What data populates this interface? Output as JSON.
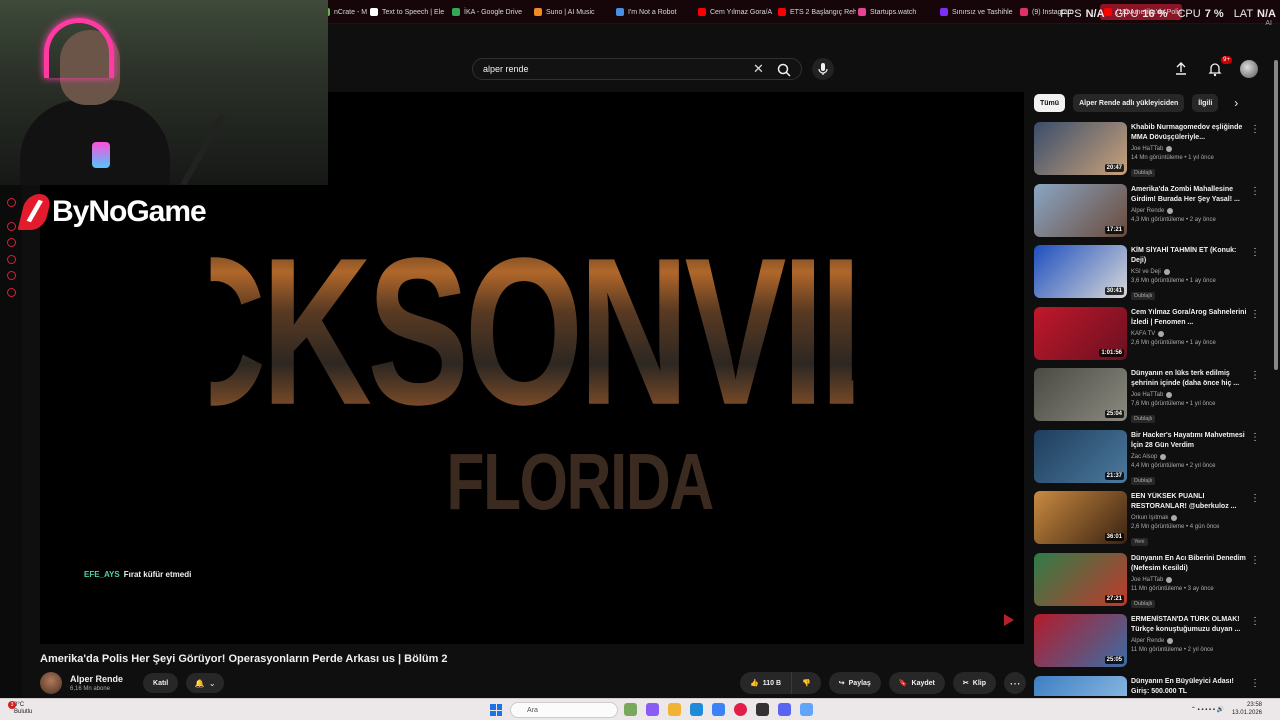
{
  "browser": {
    "tabs": [
      {
        "label": "nCrate - M",
        "color": "#6ab04c"
      },
      {
        "label": "Text to Speech | Ele",
        "color": "#ffffff"
      },
      {
        "label": "İKA - Google Drive",
        "color": "#34a853"
      },
      {
        "label": "Suno | AI Music",
        "color": "#f08a24"
      },
      {
        "label": "I'm Not a Robot",
        "color": "#4a90e2"
      },
      {
        "label": "Cem Yılmaz Gora/A",
        "color": "#ff0000"
      },
      {
        "label": "ETS 2 Başlangıç Reh",
        "color": "#ff0000"
      },
      {
        "label": "Startups.watch",
        "color": "#e84393"
      },
      {
        "label": "Sınırsız ve Tashihle",
        "color": "#7b2ff7"
      },
      {
        "label": "(9) Instagram",
        "color": "#e1306c"
      },
      {
        "label": "(18) Amerika'da Polis",
        "color": "#ff0000"
      }
    ],
    "stats": [
      {
        "label": "FPS",
        "value": "N/A"
      },
      {
        "label": "GPU",
        "value": "16 %"
      },
      {
        "label": "CPU",
        "value": "7 %"
      },
      {
        "label": "LAT",
        "value": "N/A"
      }
    ],
    "tray_label": "AI"
  },
  "overlay": {
    "logo_text": "ByNoGame"
  },
  "youtube": {
    "search": {
      "value": "alper rende",
      "placeholder": "Ara"
    },
    "notification_count": "9+",
    "video": {
      "overlay_title": "JACKSONVILLE",
      "overlay_subtitle": "FLORIDA",
      "chat_user": "EFE_AYS",
      "chat_message": "Fırat küfür etmedi",
      "title": "Amerika'da Polis Her Şeyi Görüyor! Operasyonların Perde Arkası us | Bölüm 2",
      "channel_name": "Alper Rende",
      "subscribers": "6,16 Mn abone",
      "join_label": "Katıl",
      "likes": "110 B",
      "share_label": "Paylaş",
      "save_label": "Kaydet",
      "clip_label": "Klip"
    },
    "chips": [
      "Tümü",
      "Alper Rende adlı yükleyiciden",
      "İlgili"
    ],
    "recommendations": [
      {
        "title": "Khabib Nurmagomedov eşliğinde MMA Dövüşçüleriyle...",
        "channel": "Joe HaTTab",
        "meta": "14 Mn görüntüleme • 1 yıl önce",
        "badge": "Dublajlı",
        "duration": "20:47",
        "color1": "#3a4d6b",
        "color2": "#c9a27a"
      },
      {
        "title": "Amerika'da Zombi Mahallesine Girdim! Burada Her Şey Yasal! ...",
        "channel": "Alper Rende",
        "meta": "4,3 Mn görüntüleme • 2 ay önce",
        "badge": "",
        "duration": "17:21",
        "color1": "#8aa6c4",
        "color2": "#6b4a3a"
      },
      {
        "title": "KİM SİYAHİ TAHMİN ET (Konuk: Deji)",
        "channel": "KSI ve Deji",
        "meta": "3,6 Mn görüntüleme • 1 ay önce",
        "badge": "Dublajlı",
        "duration": "30:41",
        "color1": "#1e4fbf",
        "color2": "#d8d8d8"
      },
      {
        "title": "Cem Yılmaz Gora/Arog Sahnelerini İzledi | Fenomen ...",
        "channel": "KAFA TV",
        "meta": "2,6 Mn görüntüleme • 1 ay önce",
        "badge": "",
        "duration": "1:01:56",
        "color1": "#c0182b",
        "color2": "#6a1020"
      },
      {
        "title": "Dünyanın en lüks terk edilmiş şehrinin içinde (daha önce hiç ...",
        "channel": "Joe HaTTab",
        "meta": "7,6 Mn görüntüleme • 1 yıl önce",
        "badge": "Dublajlı",
        "duration": "25:04",
        "color1": "#4a4a44",
        "color2": "#8a8a80"
      },
      {
        "title": "Bir Hacker's Hayatımı Mahvetmesi İçin 28 Gün Verdim",
        "channel": "Zac Alsop",
        "meta": "4,4 Mn görüntüleme • 2 yıl önce",
        "badge": "Dublajlı",
        "duration": "21:37",
        "color1": "#1f3d5c",
        "color2": "#4b7a9e"
      },
      {
        "title": "EEN YÜKSEK PUANLI RESTORANLAR! @uberkuloz ...",
        "channel": "Orkun Işıtmak",
        "meta": "2,6 Mn görüntüleme • 4 gün önce",
        "badge": "Yeni",
        "duration": "36:01",
        "color1": "#c98a40",
        "color2": "#3a2212"
      },
      {
        "title": "Dünyanın En Acı Biberini Denedim (Nefesim Kesildi)",
        "channel": "Joe HaTTab",
        "meta": "11 Mn görüntüleme • 3 ay önce",
        "badge": "Dublajlı",
        "duration": "27:21",
        "color1": "#2e7d4a",
        "color2": "#c0392b"
      },
      {
        "title": "ERMENİSTAN'DA TÜRK OLMAK! Türkçe konuştuğumuzu duyan ...",
        "channel": "Alper Rende",
        "meta": "11 Mn görüntüleme • 2 yıl önce",
        "badge": "",
        "duration": "25:05",
        "color1": "#b31b2b",
        "color2": "#3a6ea5"
      },
      {
        "title": "Dünyanın En Büyüleyici Adası! Giriş: 500.000 TL",
        "channel": "Alper Rende",
        "meta": "",
        "badge": "",
        "duration": "",
        "color1": "#3d7fc2",
        "color2": "#9ac4e8"
      }
    ]
  },
  "taskbar": {
    "weather_temp": "3°C",
    "weather_desc": "Bulutlu",
    "weather_badge": "3",
    "search_placeholder": "Ara",
    "time": "23:58",
    "date": "13.01.2026"
  }
}
